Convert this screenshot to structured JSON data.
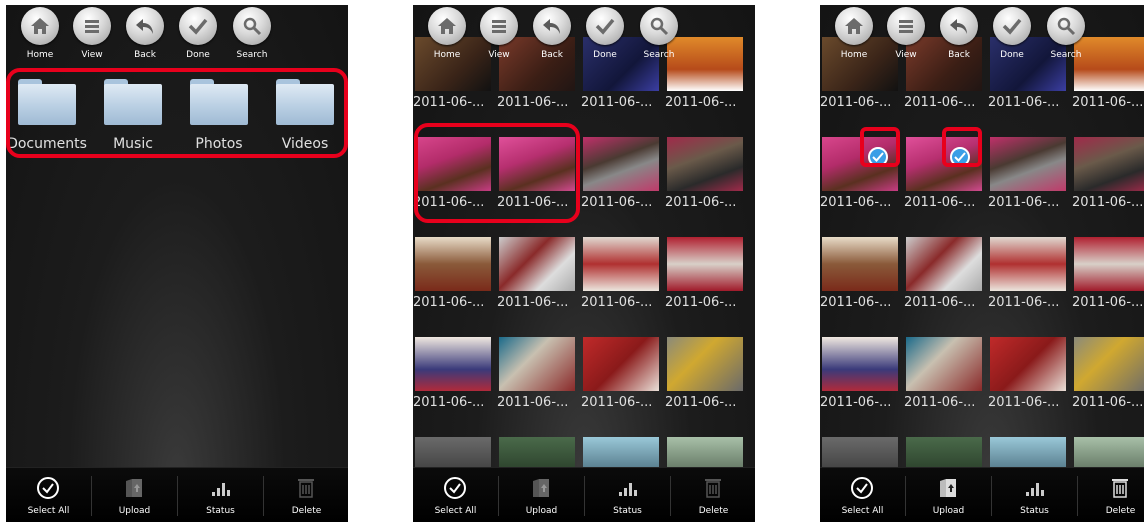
{
  "toolbar": {
    "home_label": "Home",
    "view_label": "View",
    "back_label": "Back",
    "done_label": "Done",
    "search_label": "Search"
  },
  "folders": [
    {
      "label": "Documents"
    },
    {
      "label": "Music"
    },
    {
      "label": "Photos"
    },
    {
      "label": "Videos"
    }
  ],
  "photo_label": "2011-06-...",
  "bottom_bar": {
    "select_all_label": "Select All",
    "upload_label": "Upload",
    "status_label": "Status",
    "delete_label": "Delete"
  },
  "colors": {
    "highlight": "#e8001c",
    "check_blue": "#3a9ee6",
    "folder_blue": "#b9cfe3",
    "background": "#1c1c1c"
  },
  "icons": [
    "home-icon",
    "view-list-icon",
    "back-arrow-icon",
    "done-check-icon",
    "search-icon",
    "select-all-check-icon",
    "upload-icon",
    "status-bars-icon",
    "delete-trash-icon",
    "folder-icon",
    "selected-check-icon"
  ]
}
